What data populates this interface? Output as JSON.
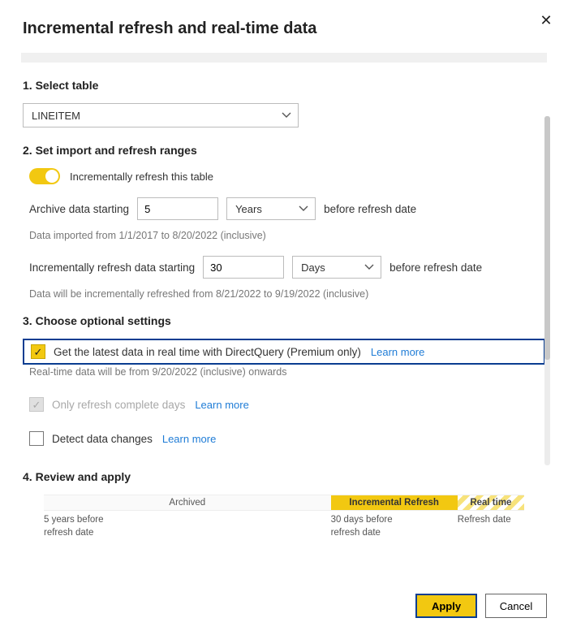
{
  "title": "Incremental refresh and real-time data",
  "close_aria": "Close",
  "sections": {
    "s1": {
      "num": "1.",
      "title": "Select table"
    },
    "s2": {
      "num": "2.",
      "title": "Set import and refresh ranges"
    },
    "s3": {
      "num": "3.",
      "title": "Choose optional settings"
    },
    "s4": {
      "num": "4.",
      "title": "Review and apply"
    }
  },
  "table_select": {
    "value": "LINEITEM"
  },
  "toggle": {
    "label": "Incrementally refresh this table",
    "on": true
  },
  "archive": {
    "prefix": "Archive data starting",
    "value": "5",
    "unit": "Years",
    "suffix": "before refresh date",
    "hint": "Data imported from 1/1/2017 to 8/20/2022 (inclusive)"
  },
  "incremental": {
    "prefix": "Incrementally refresh data starting",
    "value": "30",
    "unit": "Days",
    "suffix": "before refresh date",
    "hint": "Data will be incrementally refreshed from 8/21/2022 to 9/19/2022 (inclusive)"
  },
  "options": {
    "realtime": {
      "label": "Get the latest data in real time with DirectQuery (Premium only)",
      "learn": "Learn more",
      "checked": true
    },
    "realtime_hint": "Real-time data will be from 9/20/2022 (inclusive) onwards",
    "complete_days": {
      "label": "Only refresh complete days",
      "learn": "Learn more",
      "checked": true,
      "disabled": true
    },
    "detect": {
      "label": "Detect data changes",
      "learn": "Learn more",
      "checked": false
    }
  },
  "timeline": {
    "archived": "Archived",
    "incremental": "Incremental Refresh",
    "realtime": "Real time",
    "label_archived": "5 years before\nrefresh date",
    "label_incremental": "30 days before\nrefresh date",
    "label_refresh": "Refresh date"
  },
  "actions": {
    "apply": "Apply",
    "cancel": "Cancel"
  },
  "colors": {
    "accent": "#f2c811",
    "focus": "#0a3d91",
    "link": "#1f7cd6"
  }
}
